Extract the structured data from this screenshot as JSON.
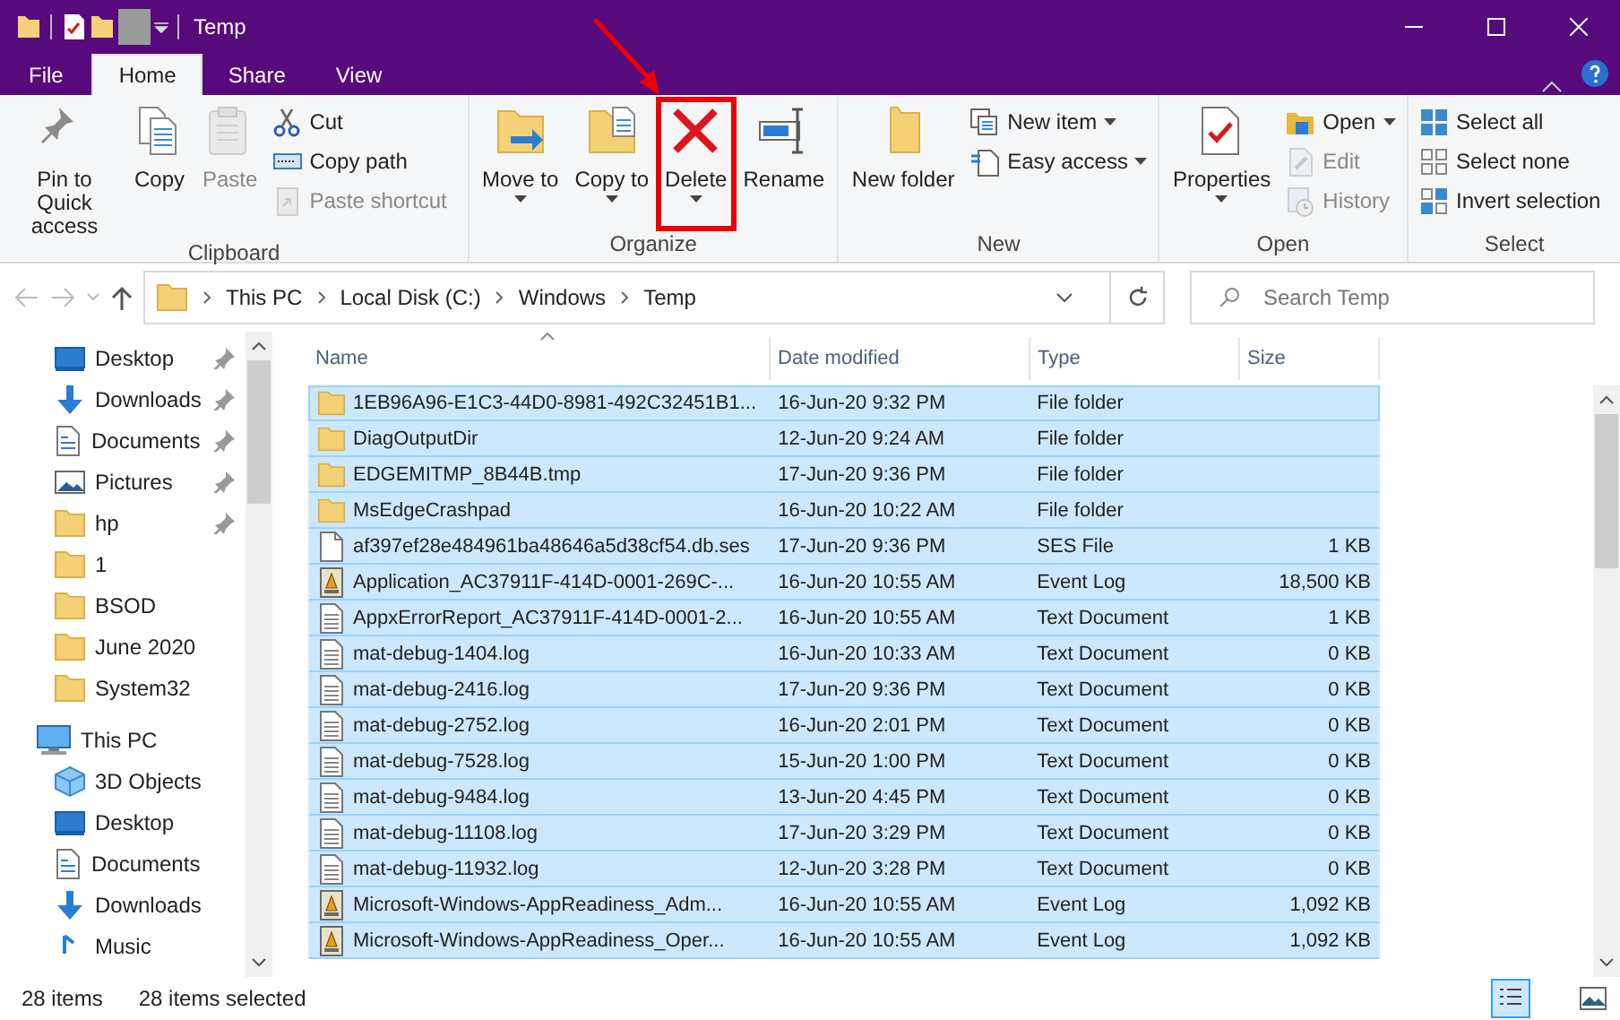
{
  "window": {
    "title": "Temp"
  },
  "ribbon": {
    "tabs": [
      {
        "label": "File",
        "kind": "file",
        "selected": false
      },
      {
        "label": "Home",
        "kind": "tab",
        "selected": true
      },
      {
        "label": "Share",
        "kind": "tab",
        "selected": false
      },
      {
        "label": "View",
        "kind": "tab",
        "selected": false
      }
    ],
    "groups": [
      {
        "label": "Clipboard",
        "items": [
          {
            "label": "Pin to Quick access",
            "kind": "large",
            "disabled": false,
            "dropdown": false
          },
          {
            "label": "Copy",
            "kind": "large",
            "disabled": false,
            "dropdown": false
          },
          {
            "label": "Paste",
            "kind": "large",
            "disabled": true,
            "dropdown": false
          },
          {
            "label": "Cut",
            "kind": "small",
            "disabled": false,
            "dropdown": false
          },
          {
            "label": "Copy path",
            "kind": "small",
            "disabled": false,
            "dropdown": false
          },
          {
            "label": "Paste shortcut",
            "kind": "small",
            "disabled": true,
            "dropdown": false
          }
        ]
      },
      {
        "label": "Organize",
        "items": [
          {
            "label": "Move to",
            "kind": "large",
            "disabled": false,
            "dropdown": true
          },
          {
            "label": "Copy to",
            "kind": "large",
            "disabled": false,
            "dropdown": true
          },
          {
            "label": "Delete",
            "kind": "large",
            "disabled": false,
            "dropdown": true,
            "highlighted": true
          },
          {
            "label": "Rename",
            "kind": "large",
            "disabled": false,
            "dropdown": false
          }
        ]
      },
      {
        "label": "New",
        "items": [
          {
            "label": "New folder",
            "kind": "large",
            "disabled": false,
            "dropdown": false
          },
          {
            "label": "New item",
            "kind": "small",
            "disabled": false,
            "dropdown": true
          },
          {
            "label": "Easy access",
            "kind": "small",
            "disabled": false,
            "dropdown": true
          }
        ]
      },
      {
        "label": "Open",
        "items": [
          {
            "label": "Properties",
            "kind": "large",
            "disabled": false,
            "dropdown": true
          },
          {
            "label": "Open",
            "kind": "small",
            "disabled": false,
            "dropdown": true
          },
          {
            "label": "Edit",
            "kind": "small",
            "disabled": true,
            "dropdown": false
          },
          {
            "label": "History",
            "kind": "small",
            "disabled": true,
            "dropdown": false
          }
        ]
      },
      {
        "label": "Select",
        "items": [
          {
            "label": "Select all",
            "kind": "small",
            "disabled": false,
            "dropdown": false
          },
          {
            "label": "Select none",
            "kind": "small",
            "disabled": false,
            "dropdown": false
          },
          {
            "label": "Invert selection",
            "kind": "small",
            "disabled": false,
            "dropdown": false
          }
        ]
      }
    ]
  },
  "address": {
    "breadcrumbs": [
      "This PC",
      "Local Disk (C:)",
      "Windows",
      "Temp"
    ],
    "search_placeholder": "Search Temp"
  },
  "sidebar": {
    "quick_access": [
      {
        "label": "Desktop",
        "kind": "desktop",
        "pinned": true
      },
      {
        "label": "Downloads",
        "kind": "downloads",
        "pinned": true
      },
      {
        "label": "Documents",
        "kind": "documents",
        "pinned": true
      },
      {
        "label": "Pictures",
        "kind": "pictures",
        "pinned": true
      },
      {
        "label": "hp",
        "kind": "folder",
        "pinned": true
      },
      {
        "label": "1",
        "kind": "folder",
        "pinned": false
      },
      {
        "label": "BSOD",
        "kind": "folder",
        "pinned": false
      },
      {
        "label": "June 2020",
        "kind": "folder",
        "pinned": false
      },
      {
        "label": "System32",
        "kind": "folder",
        "pinned": false
      }
    ],
    "tree": [
      {
        "label": "This PC",
        "kind": "pc",
        "children": [
          {
            "label": "3D Objects",
            "kind": "objects3d"
          },
          {
            "label": "Desktop",
            "kind": "desktop"
          },
          {
            "label": "Documents",
            "kind": "documents"
          },
          {
            "label": "Downloads",
            "kind": "downloads"
          },
          {
            "label": "Music",
            "kind": "music"
          }
        ]
      }
    ]
  },
  "table": {
    "columns": [
      {
        "label": "Name",
        "sorted": true
      },
      {
        "label": "Date modified",
        "sorted": false
      },
      {
        "label": "Type",
        "sorted": false
      },
      {
        "label": "Size",
        "sorted": false
      }
    ],
    "rows": [
      {
        "name": "1EB96A96-E1C3-44D0-8981-492C32451B1...",
        "date": "16-Jun-20 9:32 PM",
        "type": "File folder",
        "size": "",
        "kind": "folder",
        "selected": true,
        "focused": true
      },
      {
        "name": "DiagOutputDir",
        "date": "12-Jun-20 9:24 AM",
        "type": "File folder",
        "size": "",
        "kind": "folder",
        "selected": true,
        "focused": false
      },
      {
        "name": "EDGEMITMP_8B44B.tmp",
        "date": "17-Jun-20 9:36 PM",
        "type": "File folder",
        "size": "",
        "kind": "folder",
        "selected": true,
        "focused": false
      },
      {
        "name": "MsEdgeCrashpad",
        "date": "16-Jun-20 10:22 AM",
        "type": "File folder",
        "size": "",
        "kind": "folder",
        "selected": true,
        "focused": false
      },
      {
        "name": "af397ef28e484961ba48646a5d38cf54.db.ses",
        "date": "17-Jun-20 9:36 PM",
        "type": "SES File",
        "size": "1 KB",
        "kind": "file",
        "selected": true,
        "focused": false
      },
      {
        "name": "Application_AC37911F-414D-0001-269C-...",
        "date": "16-Jun-20 10:55 AM",
        "type": "Event Log",
        "size": "18,500 KB",
        "kind": "eventlog",
        "selected": true,
        "focused": false
      },
      {
        "name": "AppxErrorReport_AC37911F-414D-0001-2...",
        "date": "16-Jun-20 10:55 AM",
        "type": "Text Document",
        "size": "1 KB",
        "kind": "text",
        "selected": true,
        "focused": false
      },
      {
        "name": "mat-debug-1404.log",
        "date": "16-Jun-20 10:33 AM",
        "type": "Text Document",
        "size": "0 KB",
        "kind": "text",
        "selected": true,
        "focused": false
      },
      {
        "name": "mat-debug-2416.log",
        "date": "17-Jun-20 9:36 PM",
        "type": "Text Document",
        "size": "0 KB",
        "kind": "text",
        "selected": true,
        "focused": false
      },
      {
        "name": "mat-debug-2752.log",
        "date": "16-Jun-20 2:01 PM",
        "type": "Text Document",
        "size": "0 KB",
        "kind": "text",
        "selected": true,
        "focused": false
      },
      {
        "name": "mat-debug-7528.log",
        "date": "15-Jun-20 1:00 PM",
        "type": "Text Document",
        "size": "0 KB",
        "kind": "text",
        "selected": true,
        "focused": false
      },
      {
        "name": "mat-debug-9484.log",
        "date": "13-Jun-20 4:45 PM",
        "type": "Text Document",
        "size": "0 KB",
        "kind": "text",
        "selected": true,
        "focused": false
      },
      {
        "name": "mat-debug-11108.log",
        "date": "17-Jun-20 3:29 PM",
        "type": "Text Document",
        "size": "0 KB",
        "kind": "text",
        "selected": true,
        "focused": false
      },
      {
        "name": "mat-debug-11932.log",
        "date": "12-Jun-20 3:28 PM",
        "type": "Text Document",
        "size": "0 KB",
        "kind": "text",
        "selected": true,
        "focused": false
      },
      {
        "name": "Microsoft-Windows-AppReadiness_Adm...",
        "date": "16-Jun-20 10:55 AM",
        "type": "Event Log",
        "size": "1,092 KB",
        "kind": "eventlog",
        "selected": true,
        "focused": false
      },
      {
        "name": "Microsoft-Windows-AppReadiness_Oper...",
        "date": "16-Jun-20 10:55 AM",
        "type": "Event Log",
        "size": "1,092 KB",
        "kind": "eventlog",
        "selected": true,
        "focused": false
      }
    ]
  },
  "status_bar": {
    "item_count": "28 items",
    "selection": "28 items selected",
    "views": [
      {
        "kind": "details",
        "selected": true
      },
      {
        "kind": "large-icons",
        "selected": false
      }
    ]
  }
}
